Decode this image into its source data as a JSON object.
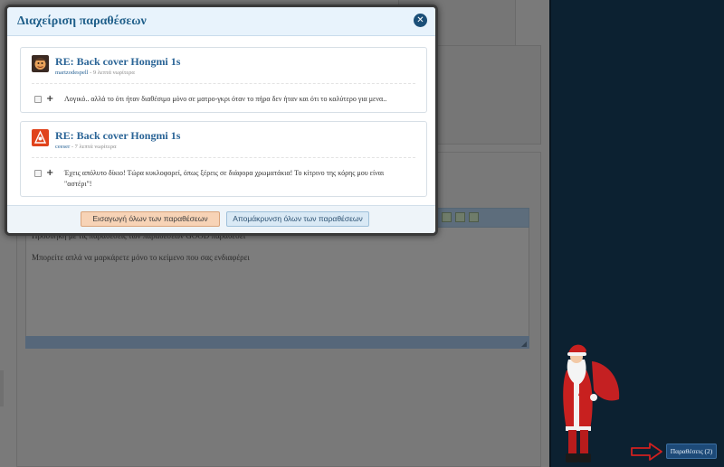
{
  "modal": {
    "title": "Διαχείριση παραθέσεων",
    "close_icon": "close-icon",
    "quotes": [
      {
        "title": "RE: Back cover Hongmi 1s",
        "author": "martzodespell",
        "time": " - 9 λεπτά νωρίτερα",
        "text": "Λογικό.. αλλά το ότι ήταν διαθέσιμο μόνο σε ματρο-γκρι όταν το πήρα δεν ήταν και ότι το καλύτερο για μενα..",
        "text2": ""
      },
      {
        "title": "RE: Back cover Hongmi 1s",
        "author": "ceeser",
        "time": " - 7 λεπτά νωρίτερα",
        "text": "Έχεις απόλυτο δίκιο! Τώρα κυκλοφορεί, όπως ξέρεις σε διάφορα χρωματάκια! Το κίτρινο της κόρης μου είναι",
        "text2": "\"αστέρι\"!"
      }
    ],
    "insert_all_label": "Εισαγωγή όλων των παραθέσεων",
    "remove_all_label": "Απομάκρυνση όλων των παραθέσεων"
  },
  "editor": {
    "line1": "Προσθήκη με τις παραθέσεις των παραθέσεων GOOD παραθέσει",
    "line2": "Μπορείτε απλά να μαρκάρετε μόνο το κείμενο που σας ενδιαφέρει"
  },
  "quotes_button": {
    "label": "Παραθέσεις (2)"
  },
  "colors": {
    "modal_title": "#1f5f8a",
    "quote_link": "#2a6496",
    "insert_button_bg": "#f7d3b6",
    "remove_button_bg": "#d9e9f5",
    "dark_background": "#0c2131",
    "arrow": "#d0201f"
  },
  "icons": {
    "close": "close-icon",
    "checkbox": "checkbox",
    "plus": "plus-icon",
    "arrow": "right-arrow-icon",
    "santa": "santa-figure"
  }
}
